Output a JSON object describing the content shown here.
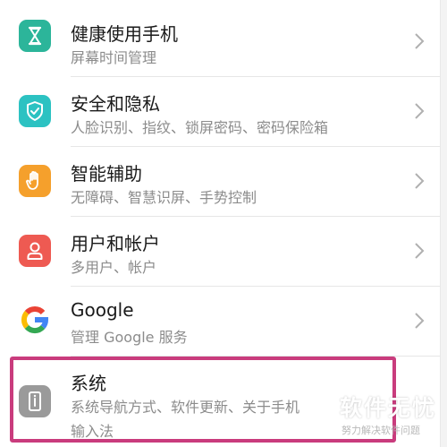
{
  "settings": {
    "items": [
      {
        "title": "健康使用手机",
        "subtitle": "屏幕时间管理",
        "icon": "hourglass-icon",
        "color": "#2cb59a"
      },
      {
        "title": "安全和隐私",
        "subtitle": "人脸识别、指纹、锁屏密码、密码保险箱",
        "icon": "shield-check-icon",
        "color": "#2cc2c2"
      },
      {
        "title": "智能辅助",
        "subtitle": "无障碍、智慧识屏、手势控制",
        "icon": "hand-icon",
        "color": "#f5a02c"
      },
      {
        "title": "用户和帐户",
        "subtitle": "多用户、帐户",
        "icon": "user-icon",
        "color": "#ee5a52"
      },
      {
        "title": "Google",
        "subtitle": "管理 Google 服务",
        "icon": "google-icon",
        "color": "#ffffff"
      },
      {
        "title": "系统",
        "subtitle": "系统导航方式、软件更新、关于手机",
        "subtitle2": "输入法",
        "icon": "phone-info-icon",
        "color": "#9a9a9a"
      }
    ]
  },
  "annotation": {
    "highlight_color": "#c93c7d"
  },
  "watermark": {
    "main": "软件无忧",
    "sub": "努力解决软件问题"
  }
}
